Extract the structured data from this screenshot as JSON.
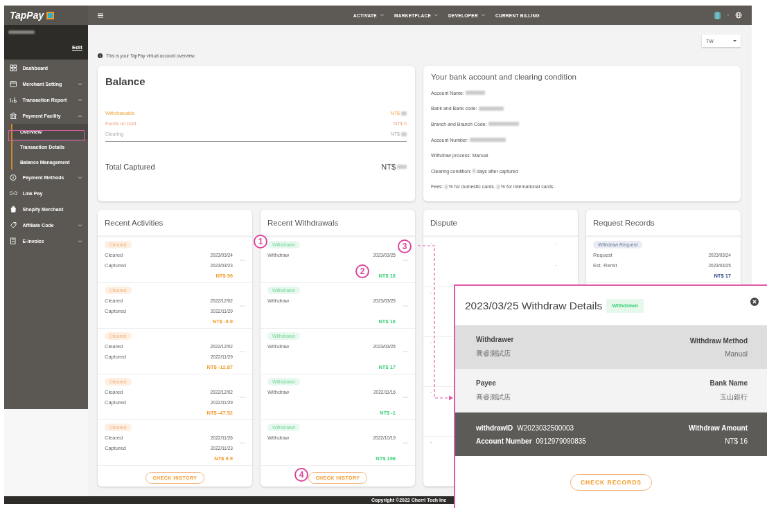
{
  "sidebar": {
    "logo": "TapPay",
    "user": {
      "name_blurred": true,
      "edit": "Edit"
    },
    "items": [
      {
        "label": "Dashboard",
        "kind": "link"
      },
      {
        "label": "Merchant Setting",
        "kind": "group",
        "expanded": false
      },
      {
        "label": "Transaction Report",
        "kind": "group",
        "expanded": false
      },
      {
        "label": "Payment Facility",
        "kind": "group",
        "expanded": true,
        "children": [
          {
            "label": "Overview",
            "selected": true
          },
          {
            "label": "Transaction Details",
            "selected": false
          },
          {
            "label": "Balance Management",
            "selected": false
          }
        ]
      },
      {
        "label": "Payment Methods",
        "kind": "group",
        "expanded": false
      },
      {
        "label": "Link Pay",
        "kind": "link"
      },
      {
        "label": "Shopify Merchant",
        "kind": "link"
      },
      {
        "label": "Affiliate Code",
        "kind": "group",
        "expanded": false
      },
      {
        "label": "E-Invoice",
        "kind": "group",
        "expanded": false
      }
    ]
  },
  "topbar": {
    "nav": [
      {
        "label": "ACTIVATE",
        "dropdown": true
      },
      {
        "label": "MARKETPLACE",
        "dropdown": true
      },
      {
        "label": "DEVELOPER",
        "dropdown": true
      },
      {
        "label": "CURRENT BILLING",
        "dropdown": false
      }
    ]
  },
  "region_select": {
    "value": "TW"
  },
  "info": "This is your TapPay virtual account overview.",
  "balance": {
    "title": "Balance",
    "rows": [
      {
        "kind": "withdrawable",
        "label": "Withdrawable",
        "amount": "NT$",
        "blurred": true
      },
      {
        "kind": "hold",
        "label": "Funds on hold",
        "amount": "NT$ 0",
        "blurred": false
      },
      {
        "kind": "clearing",
        "label": "Clearing",
        "amount": "NT$",
        "blurred": true
      }
    ],
    "total": {
      "label": "Total Captured",
      "amount": "NT$",
      "blurred": true
    }
  },
  "bank": {
    "title": "Your bank account and clearing condition",
    "lines": [
      [
        {
          "kind": "text",
          "text": "Account Name:"
        },
        {
          "kind": "blur"
        }
      ],
      [
        {
          "kind": "text",
          "text": "Bank and Bank code:"
        },
        {
          "kind": "blur"
        }
      ],
      [
        {
          "kind": "text",
          "text": "Branch and Branch Code:"
        },
        {
          "kind": "blur"
        }
      ],
      [
        {
          "kind": "text",
          "text": "Account Number:"
        },
        {
          "kind": "blur"
        }
      ],
      [
        {
          "kind": "text",
          "text": "Withdraw process: Manual"
        }
      ],
      [
        {
          "kind": "text",
          "text": "Clearing condition:"
        },
        {
          "kind": "blur"
        },
        {
          "kind": "text",
          "text": "days after captured"
        }
      ],
      [
        {
          "kind": "text",
          "text": "Fees:"
        },
        {
          "kind": "blur"
        },
        {
          "kind": "text",
          "text": "% for domestic cards."
        },
        {
          "kind": "blur"
        },
        {
          "kind": "text",
          "text": "% for international cards."
        }
      ]
    ]
  },
  "activities": {
    "title": "Recent Activities",
    "button": "CHECK HISTORY",
    "rows": [
      {
        "badge": "Cleared",
        "lines": [
          {
            "label": "Cleared",
            "date": "2023/03/24"
          },
          {
            "label": "Captured",
            "date": "2023/03/23"
          }
        ],
        "amount": "NT$ 99"
      },
      {
        "badge": "Cleared",
        "lines": [
          {
            "label": "Cleared",
            "date": "2022/12/02"
          },
          {
            "label": "Captured",
            "date": "2022/11/29"
          }
        ],
        "amount": "NT$ -9.9"
      },
      {
        "badge": "Cleared",
        "lines": [
          {
            "label": "Cleared",
            "date": "2022/12/02"
          },
          {
            "label": "Captured",
            "date": "2022/11/29"
          }
        ],
        "amount": "NT$ -12.87"
      },
      {
        "badge": "Cleared",
        "lines": [
          {
            "label": "Cleared",
            "date": "2022/12/02"
          },
          {
            "label": "Captured",
            "date": "2022/11/29"
          }
        ],
        "amount": "NT$ -47.52"
      },
      {
        "badge": "Cleared",
        "lines": [
          {
            "label": "Cleared",
            "date": "2022/11/26"
          },
          {
            "label": "Captured",
            "date": "2022/11/23"
          }
        ],
        "amount": "NT$ 9.9"
      }
    ]
  },
  "withdrawals": {
    "title": "Recent Withdrawals",
    "button": "CHECK HISTORY",
    "rows": [
      {
        "badge": "Withdrawn",
        "lines": [
          {
            "label": "Withdraw",
            "date": "2023/03/25"
          }
        ],
        "amount": "NT$ 16"
      },
      {
        "badge": "Withdrawn",
        "lines": [
          {
            "label": "Withdraw",
            "date": "2023/03/25"
          }
        ],
        "amount": "NT$ 16"
      },
      {
        "badge": "Withdrawn",
        "lines": [
          {
            "label": "Withdraw",
            "date": "2023/03/25"
          }
        ],
        "amount": "NT$ 17"
      },
      {
        "badge": "Withdrawn",
        "lines": [
          {
            "label": "Withdraw",
            "date": "2022/11/16"
          }
        ],
        "amount": "NT$ -1"
      },
      {
        "badge": "Withdrawn",
        "lines": [
          {
            "label": "Withdraw",
            "date": "2022/10/19"
          }
        ],
        "amount": "NT$ 198"
      }
    ]
  },
  "dispute": {
    "title": "Dispute",
    "rows": [
      {
        "left": "-",
        "right": "-",
        "amount": "-"
      },
      {
        "left": "-"
      },
      {
        "left": "-"
      },
      {
        "left": "-"
      },
      {
        "left": "-"
      }
    ]
  },
  "requests": {
    "title": "Request Records",
    "rows": [
      {
        "badge": "Withdraw Request",
        "lines": [
          {
            "label": "Request",
            "date": "2023/03/24"
          },
          {
            "label": "Est. Remit",
            "date": "2023/03/25"
          }
        ],
        "amount": "NT$ 17"
      }
    ]
  },
  "footer": "Copyright ©2022 Cherri Tech Inc",
  "detail": {
    "title": "2023/03/25 Withdraw Details",
    "badge": "Withdrawn",
    "button": "CHECK RECORDS",
    "sections": [
      {
        "kind": "grey",
        "left": {
          "kind": "stacked",
          "items": [
            {
              "label": "Withdrawer",
              "value": "喬睿測試店"
            }
          ]
        },
        "right": {
          "kind": "stacked",
          "items": [
            {
              "label": "Withdraw Method",
              "value": "Manual"
            }
          ]
        }
      },
      {
        "kind": "light",
        "left": {
          "kind": "stacked",
          "items": [
            {
              "label": "Payee",
              "value": "喬睿測試店"
            }
          ]
        },
        "right": {
          "kind": "stacked",
          "items": [
            {
              "label": "Bank Name",
              "value": "玉山銀行"
            }
          ]
        }
      },
      {
        "kind": "dark",
        "left": {
          "kind": "inline",
          "items": [
            {
              "label": "withdrawID",
              "value": "W2023032500003"
            },
            {
              "label": "Account Number",
              "value": "0912979090835"
            }
          ]
        },
        "right": {
          "kind": "stacked",
          "items": [
            {
              "label": "Withdraw Amount",
              "value": "NT$ 16"
            }
          ]
        }
      }
    ]
  },
  "annotations": {
    "markers": [
      "1",
      "2",
      "3",
      "4"
    ]
  }
}
